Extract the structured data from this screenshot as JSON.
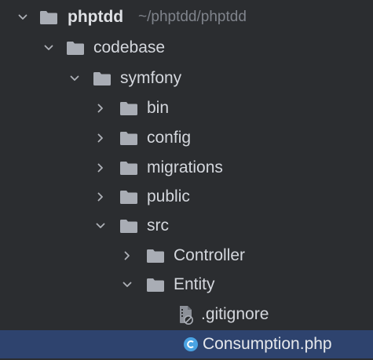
{
  "project": {
    "name": "phptdd",
    "path": "~/phptdd/phptdd"
  },
  "tree": [
    {
      "label": "codebase",
      "expanded": true
    },
    {
      "label": "symfony",
      "expanded": true
    },
    {
      "label": "bin",
      "expanded": false
    },
    {
      "label": "config",
      "expanded": false
    },
    {
      "label": "migrations",
      "expanded": false
    },
    {
      "label": "public",
      "expanded": false
    },
    {
      "label": "src",
      "expanded": true
    },
    {
      "label": "Controller",
      "expanded": false
    },
    {
      "label": "Entity",
      "expanded": true
    },
    {
      "label": ".gitignore"
    },
    {
      "label": "Consumption.php",
      "selected": true
    }
  ],
  "icons": {
    "folder": "folder-icon",
    "expanded": "chevron-down-icon",
    "collapsed": "chevron-right-icon",
    "gitignore": "gitignore-file-icon",
    "php_class": "php-class-icon"
  },
  "colors": {
    "background": "#2b2d30",
    "selection": "#2e436e",
    "folder": "#a9adb5",
    "class_icon": "#4aa3e3",
    "path_text": "#7f838b"
  }
}
